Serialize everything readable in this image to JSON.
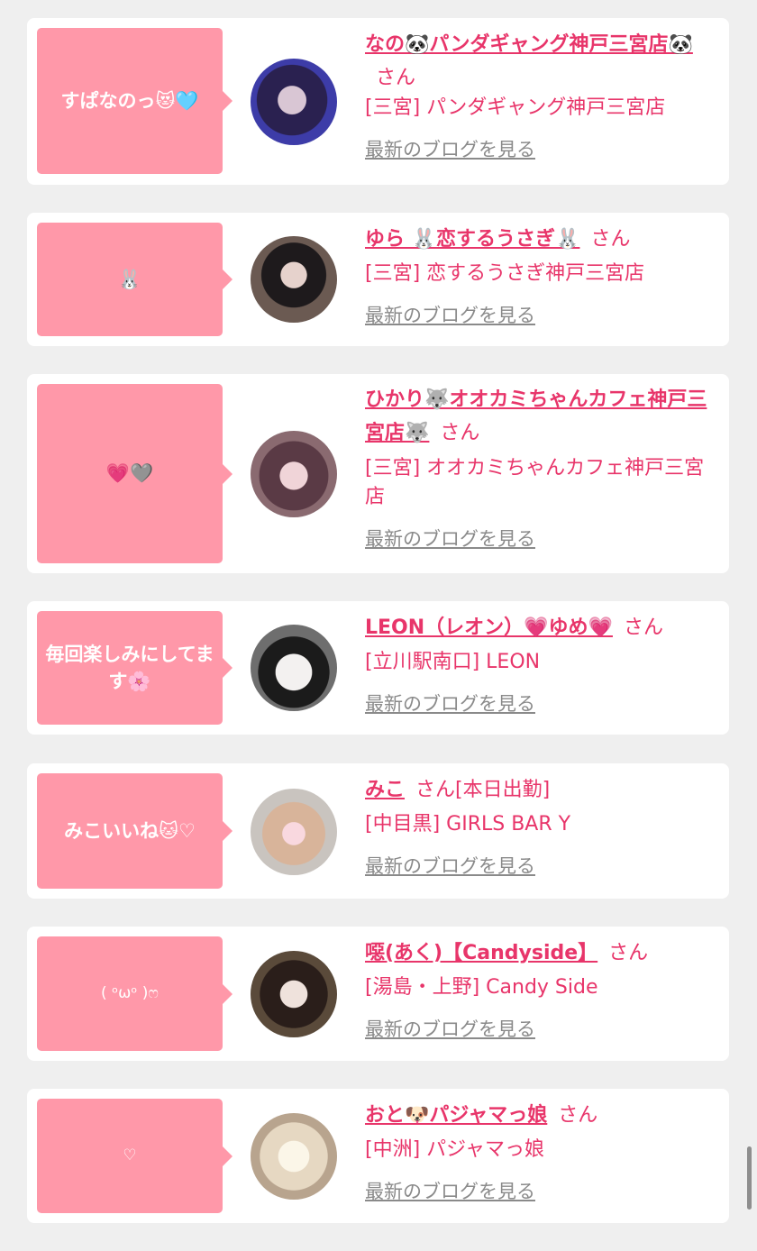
{
  "cards": [
    {
      "comment": "すぱなのっ😻🩵",
      "name": "なの🐼パンダギャング神戸三宮店🐼",
      "san": "さん",
      "note": "",
      "shop": "[三宮] パンダギャング神戸三宮店",
      "blog": "最新のブログを見る"
    },
    {
      "comment": "🐰",
      "name": "ゆら 🐰恋するうさぎ🐰",
      "san": "さん",
      "note": "",
      "shop": "[三宮] 恋するうさぎ神戸三宮店",
      "blog": "最新のブログを見る"
    },
    {
      "comment": "💗🩶",
      "name": "ひかり🐺オオカミちゃんカフェ神戸三宮店🐺",
      "san": "さん",
      "note": "",
      "shop": "[三宮] オオカミちゃんカフェ神戸三宮店",
      "blog": "最新のブログを見る"
    },
    {
      "comment": "毎回楽しみにしてます🌸",
      "name": "LEON（レオン）💗ゆめ💗",
      "san": "さん",
      "note": "",
      "shop": "[立川駅南口] LEON",
      "blog": "最新のブログを見る"
    },
    {
      "comment": "みこいいね🐱♡",
      "name": "みこ",
      "san": "さん",
      "note": "[本日出勤]",
      "shop": "[中目黒] GIRLS BAR Y",
      "blog": "最新のブログを見る"
    },
    {
      "comment": "(  ᵒωᵒ  )ෆ",
      "name": "噁(あく)【Candyside】",
      "san": "さん",
      "note": "",
      "shop": "[湯島・上野] Candy Side",
      "blog": "最新のブログを見る"
    },
    {
      "comment": "♡",
      "name": "おと🐶パジャマっ娘",
      "san": "さん",
      "note": "",
      "shop": "[中洲] パジャマっ娘",
      "blog": "最新のブログを見る"
    }
  ]
}
